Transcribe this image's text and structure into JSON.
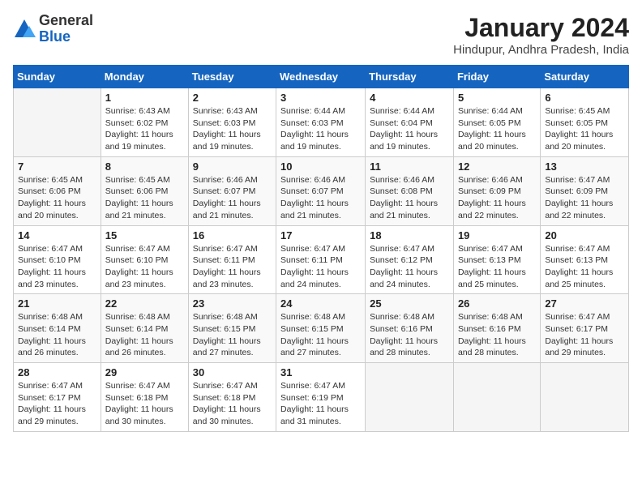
{
  "logo": {
    "general": "General",
    "blue": "Blue"
  },
  "title": "January 2024",
  "location": "Hindupur, Andhra Pradesh, India",
  "weekdays": [
    "Sunday",
    "Monday",
    "Tuesday",
    "Wednesday",
    "Thursday",
    "Friday",
    "Saturday"
  ],
  "weeks": [
    [
      {
        "day": "",
        "info": ""
      },
      {
        "day": "1",
        "info": "Sunrise: 6:43 AM\nSunset: 6:02 PM\nDaylight: 11 hours\nand 19 minutes."
      },
      {
        "day": "2",
        "info": "Sunrise: 6:43 AM\nSunset: 6:03 PM\nDaylight: 11 hours\nand 19 minutes."
      },
      {
        "day": "3",
        "info": "Sunrise: 6:44 AM\nSunset: 6:03 PM\nDaylight: 11 hours\nand 19 minutes."
      },
      {
        "day": "4",
        "info": "Sunrise: 6:44 AM\nSunset: 6:04 PM\nDaylight: 11 hours\nand 19 minutes."
      },
      {
        "day": "5",
        "info": "Sunrise: 6:44 AM\nSunset: 6:05 PM\nDaylight: 11 hours\nand 20 minutes."
      },
      {
        "day": "6",
        "info": "Sunrise: 6:45 AM\nSunset: 6:05 PM\nDaylight: 11 hours\nand 20 minutes."
      }
    ],
    [
      {
        "day": "7",
        "info": "Sunrise: 6:45 AM\nSunset: 6:06 PM\nDaylight: 11 hours\nand 20 minutes."
      },
      {
        "day": "8",
        "info": "Sunrise: 6:45 AM\nSunset: 6:06 PM\nDaylight: 11 hours\nand 21 minutes."
      },
      {
        "day": "9",
        "info": "Sunrise: 6:46 AM\nSunset: 6:07 PM\nDaylight: 11 hours\nand 21 minutes."
      },
      {
        "day": "10",
        "info": "Sunrise: 6:46 AM\nSunset: 6:07 PM\nDaylight: 11 hours\nand 21 minutes."
      },
      {
        "day": "11",
        "info": "Sunrise: 6:46 AM\nSunset: 6:08 PM\nDaylight: 11 hours\nand 21 minutes."
      },
      {
        "day": "12",
        "info": "Sunrise: 6:46 AM\nSunset: 6:09 PM\nDaylight: 11 hours\nand 22 minutes."
      },
      {
        "day": "13",
        "info": "Sunrise: 6:47 AM\nSunset: 6:09 PM\nDaylight: 11 hours\nand 22 minutes."
      }
    ],
    [
      {
        "day": "14",
        "info": "Sunrise: 6:47 AM\nSunset: 6:10 PM\nDaylight: 11 hours\nand 23 minutes."
      },
      {
        "day": "15",
        "info": "Sunrise: 6:47 AM\nSunset: 6:10 PM\nDaylight: 11 hours\nand 23 minutes."
      },
      {
        "day": "16",
        "info": "Sunrise: 6:47 AM\nSunset: 6:11 PM\nDaylight: 11 hours\nand 23 minutes."
      },
      {
        "day": "17",
        "info": "Sunrise: 6:47 AM\nSunset: 6:11 PM\nDaylight: 11 hours\nand 24 minutes."
      },
      {
        "day": "18",
        "info": "Sunrise: 6:47 AM\nSunset: 6:12 PM\nDaylight: 11 hours\nand 24 minutes."
      },
      {
        "day": "19",
        "info": "Sunrise: 6:47 AM\nSunset: 6:13 PM\nDaylight: 11 hours\nand 25 minutes."
      },
      {
        "day": "20",
        "info": "Sunrise: 6:47 AM\nSunset: 6:13 PM\nDaylight: 11 hours\nand 25 minutes."
      }
    ],
    [
      {
        "day": "21",
        "info": "Sunrise: 6:48 AM\nSunset: 6:14 PM\nDaylight: 11 hours\nand 26 minutes."
      },
      {
        "day": "22",
        "info": "Sunrise: 6:48 AM\nSunset: 6:14 PM\nDaylight: 11 hours\nand 26 minutes."
      },
      {
        "day": "23",
        "info": "Sunrise: 6:48 AM\nSunset: 6:15 PM\nDaylight: 11 hours\nand 27 minutes."
      },
      {
        "day": "24",
        "info": "Sunrise: 6:48 AM\nSunset: 6:15 PM\nDaylight: 11 hours\nand 27 minutes."
      },
      {
        "day": "25",
        "info": "Sunrise: 6:48 AM\nSunset: 6:16 PM\nDaylight: 11 hours\nand 28 minutes."
      },
      {
        "day": "26",
        "info": "Sunrise: 6:48 AM\nSunset: 6:16 PM\nDaylight: 11 hours\nand 28 minutes."
      },
      {
        "day": "27",
        "info": "Sunrise: 6:47 AM\nSunset: 6:17 PM\nDaylight: 11 hours\nand 29 minutes."
      }
    ],
    [
      {
        "day": "28",
        "info": "Sunrise: 6:47 AM\nSunset: 6:17 PM\nDaylight: 11 hours\nand 29 minutes."
      },
      {
        "day": "29",
        "info": "Sunrise: 6:47 AM\nSunset: 6:18 PM\nDaylight: 11 hours\nand 30 minutes."
      },
      {
        "day": "30",
        "info": "Sunrise: 6:47 AM\nSunset: 6:18 PM\nDaylight: 11 hours\nand 30 minutes."
      },
      {
        "day": "31",
        "info": "Sunrise: 6:47 AM\nSunset: 6:19 PM\nDaylight: 11 hours\nand 31 minutes."
      },
      {
        "day": "",
        "info": ""
      },
      {
        "day": "",
        "info": ""
      },
      {
        "day": "",
        "info": ""
      }
    ]
  ]
}
